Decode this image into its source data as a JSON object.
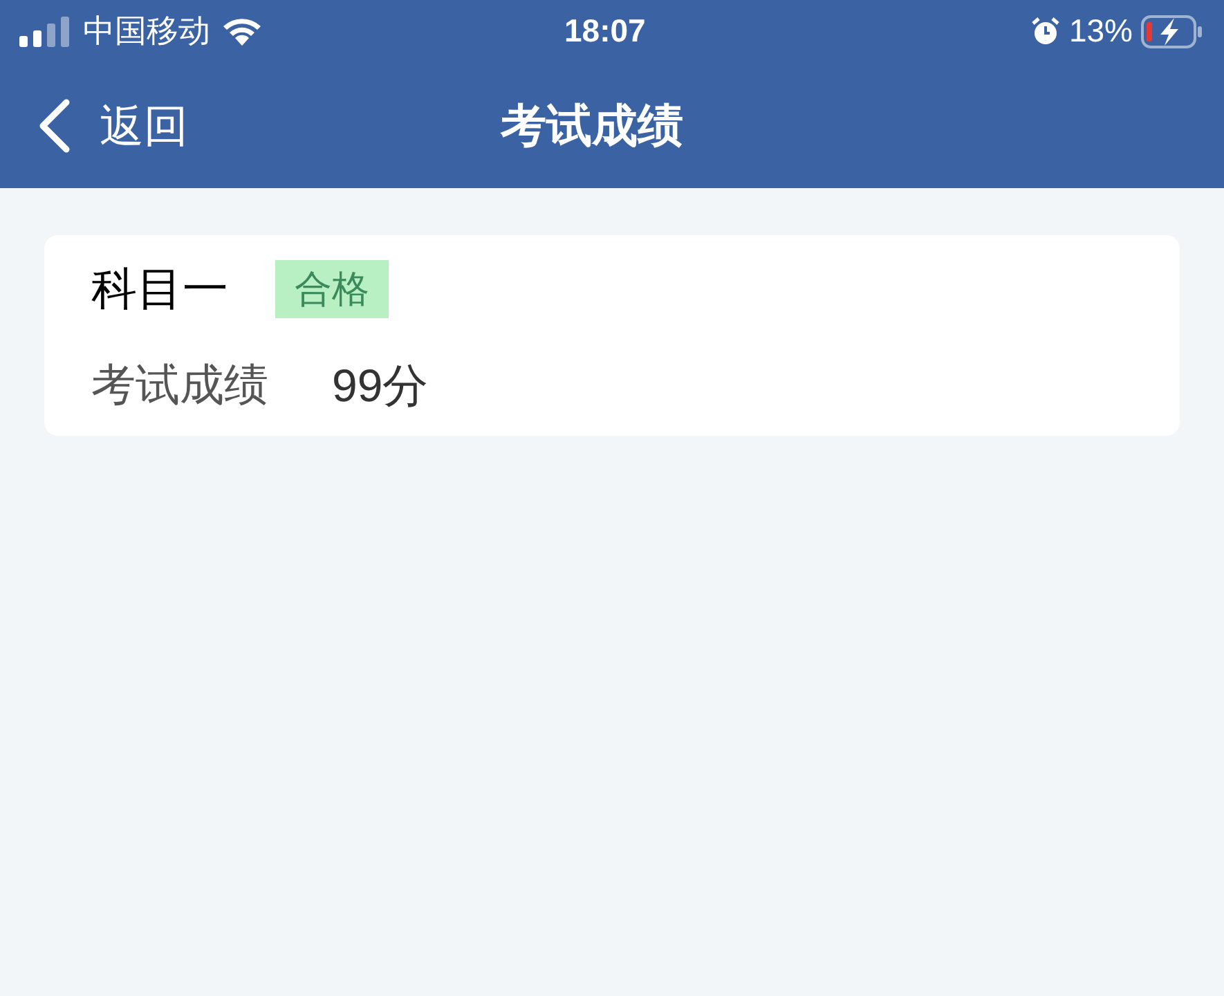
{
  "status_bar": {
    "carrier": "中国移动",
    "time": "18:07",
    "battery_percent": "13%",
    "charging": true
  },
  "nav_bar": {
    "back_label": "返回",
    "title": "考试成绩"
  },
  "results": [
    {
      "subject": "科目一",
      "badge": "合格",
      "score_label": "考试成绩",
      "score": "99分"
    }
  ]
}
